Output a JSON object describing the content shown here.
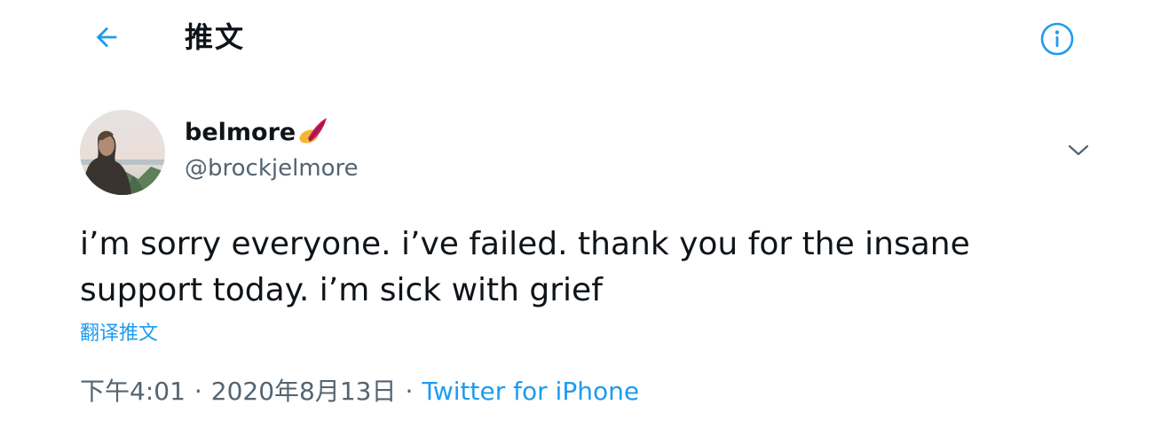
{
  "header": {
    "title": "推文",
    "back_icon": "arrow-left-icon",
    "info_icon": "info-circle-icon"
  },
  "colors": {
    "accent": "#1d9bf0",
    "text_primary": "#0f1419",
    "text_secondary": "#536471",
    "background": "#ffffff"
  },
  "tweet": {
    "author": {
      "display_name": "belmore",
      "name_emoji": "badge-emoji-icon",
      "handle": "@brockjelmore"
    },
    "more_icon": "chevron-down-icon",
    "text": "i’m sorry everyone. i’ve failed. thank you for the insane\nsupport today. i’m sick with grief",
    "translate_label": "翻译推文",
    "time": "下午4:01",
    "separator": "·",
    "date": "2020年8月13日",
    "source": "Twitter for iPhone"
  }
}
